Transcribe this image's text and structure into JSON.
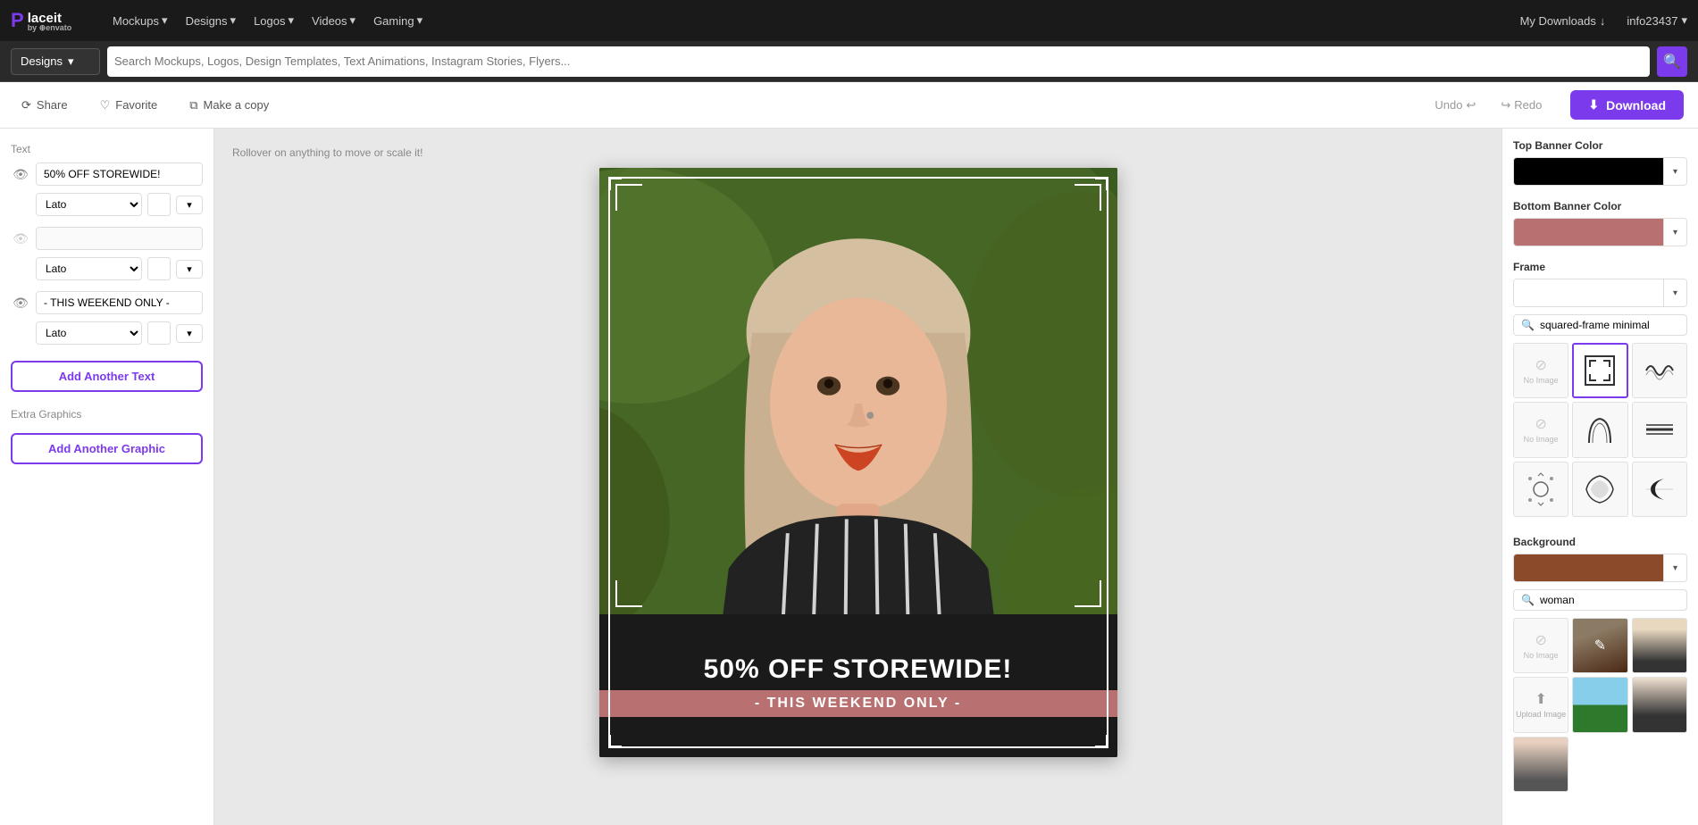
{
  "nav": {
    "brand_name": "Placeit",
    "brand_by": "by ⊕envato",
    "items": [
      {
        "label": "Mockups",
        "id": "mockups"
      },
      {
        "label": "Designs",
        "id": "designs"
      },
      {
        "label": "Logos",
        "id": "logos"
      },
      {
        "label": "Videos",
        "id": "videos"
      },
      {
        "label": "Gaming",
        "id": "gaming"
      }
    ],
    "my_downloads": "My Downloads",
    "user": "info23437"
  },
  "search": {
    "dropdown_label": "Designs",
    "placeholder": "Search Mockups, Logos, Design Templates, Text Animations, Instagram Stories, Flyers..."
  },
  "toolbar": {
    "share_label": "Share",
    "favorite_label": "Favorite",
    "make_copy_label": "Make a copy",
    "undo_label": "Undo",
    "redo_label": "Redo",
    "download_label": "Download"
  },
  "left_panel": {
    "text_label": "Text",
    "text_fields": [
      {
        "value": "50% OFF STOREWIDE!",
        "visible": true
      },
      {
        "value": "",
        "visible": false
      },
      {
        "value": "- THIS WEEKEND ONLY -",
        "visible": true
      }
    ],
    "font_name": "Lato",
    "add_text_label": "Add Another Text",
    "extra_graphics_label": "Extra Graphics",
    "add_graphic_label": "Add Another Graphic"
  },
  "canvas": {
    "hint": "Rollover on anything to move or scale it!",
    "main_text": "50% OFF STOREWIDE!",
    "sub_text": "- THIS WEEKEND ONLY -"
  },
  "right_panel": {
    "top_banner_color_label": "Top Banner Color",
    "top_banner_color": "#000000",
    "bottom_banner_color_label": "Bottom Banner Color",
    "bottom_banner_color": "#b87070",
    "frame_label": "Frame",
    "frame_search_placeholder": "squared-frame minimal",
    "background_label": "Background",
    "background_color": "#8b4a2a",
    "bg_search_placeholder": "woman",
    "frame_thumbs": [
      {
        "type": "no-img",
        "label": "No Image"
      },
      {
        "type": "frame",
        "label": "Square Frame"
      },
      {
        "type": "wavy",
        "label": "Wavy Line"
      },
      {
        "type": "no-img2",
        "label": "No Image"
      },
      {
        "type": "arch",
        "label": "Arch"
      },
      {
        "type": "lines",
        "label": "Lines"
      },
      {
        "type": "gear",
        "label": "Gear Dots"
      },
      {
        "type": "blob",
        "label": "Blob"
      },
      {
        "type": "crescent",
        "label": "Crescent"
      }
    ],
    "bg_thumbs": [
      {
        "type": "no-img",
        "label": "No Image"
      },
      {
        "type": "woman1",
        "label": "Woman Portrait"
      },
      {
        "type": "woman2",
        "label": "Woman"
      },
      {
        "type": "upload",
        "label": "Upload Image"
      },
      {
        "type": "landscape",
        "label": "Landscape"
      },
      {
        "type": "woman3",
        "label": "Woman 3"
      },
      {
        "type": "woman4",
        "label": "Woman 4"
      }
    ]
  }
}
